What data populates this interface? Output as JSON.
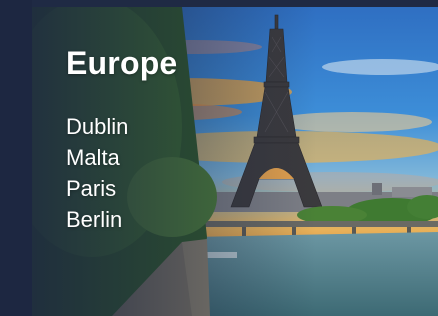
{
  "card": {
    "title": "Europe",
    "cities": [
      {
        "label": "Dublin"
      },
      {
        "label": "Malta"
      },
      {
        "label": "Paris"
      },
      {
        "label": "Berlin"
      }
    ],
    "image_subject": "eiffel-tower-seine-sunset",
    "colors": {
      "page_background": "#1d2741",
      "text": "#ffffff",
      "sky_top": "#2a7fd0",
      "sky_sunset": "#f0a53a",
      "river": "#4f7e86",
      "trees": "#3c6b2f"
    }
  }
}
